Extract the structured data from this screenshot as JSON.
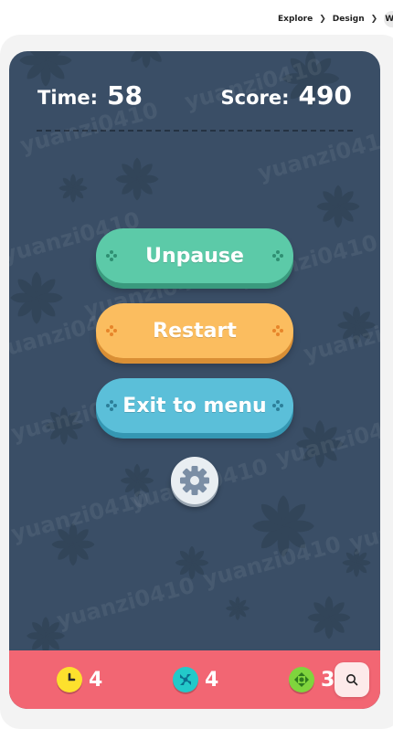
{
  "breadcrumb": {
    "items": [
      "Explore",
      "Design"
    ],
    "last_fragment": "W"
  },
  "hud": {
    "time_label": "Time:",
    "time_value": "58",
    "score_label": "Score:",
    "score_value": "490"
  },
  "menu": {
    "unpause_label": "Unpause",
    "restart_label": "Restart",
    "exit_label": "Exit to menu"
  },
  "settings": {
    "icon": "gear-icon"
  },
  "powerups": [
    {
      "icon": "clock-icon",
      "count": "4",
      "color": "#fde12d"
    },
    {
      "icon": "arrows-in-icon",
      "count": "4",
      "color": "#23c9c9"
    },
    {
      "icon": "arrows-out-icon",
      "count": "3",
      "color": "#7fd43d"
    }
  ],
  "watermark": "yuanzi0410",
  "colors": {
    "background": "#3a4e66",
    "bottom_bar": "#f26673",
    "unpause": "#5ccaa8",
    "restart": "#fbbd5f",
    "exit": "#5bbfd9"
  },
  "search_button": {
    "icon": "search-icon"
  }
}
